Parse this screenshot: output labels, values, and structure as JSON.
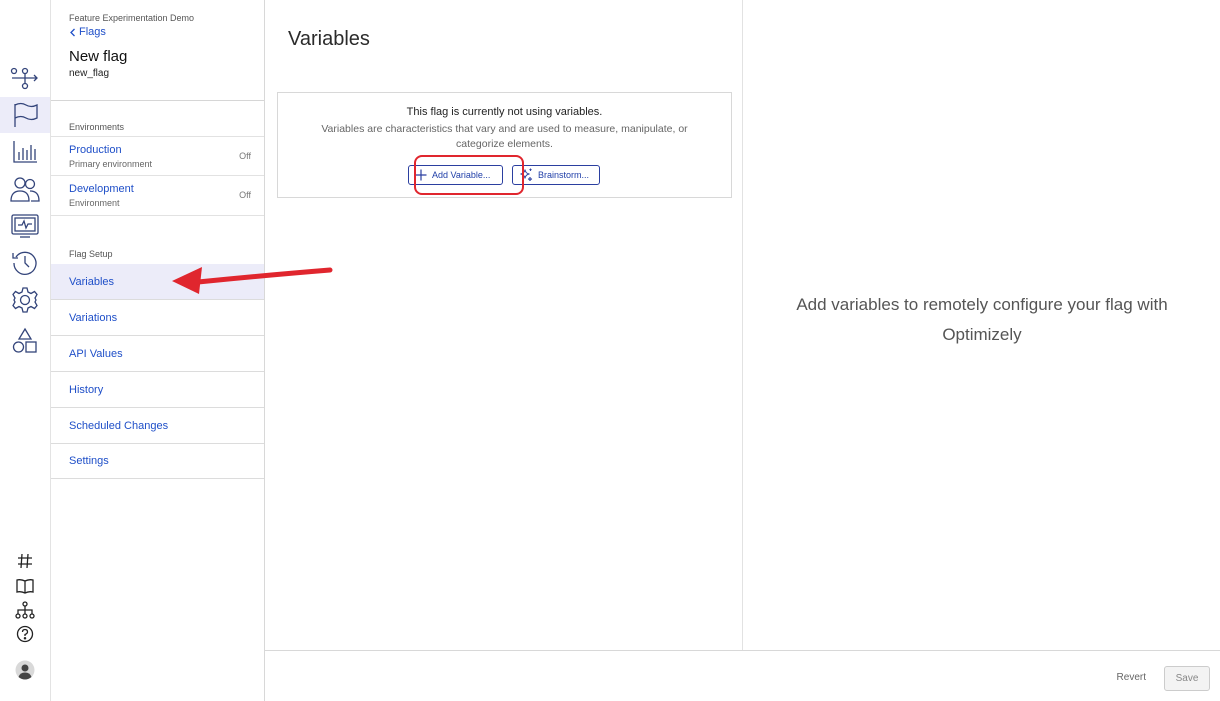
{
  "header": {
    "project": "Feature Experimentation Demo",
    "back_label": "Flags",
    "flag_name": "New flag",
    "flag_key": "new_flag"
  },
  "environments": {
    "label": "Environments",
    "items": [
      {
        "name": "Production",
        "subtitle": "Primary environment",
        "status": "Off"
      },
      {
        "name": "Development",
        "subtitle": "Environment",
        "status": "Off"
      }
    ]
  },
  "flag_setup": {
    "label": "Flag Setup",
    "items": [
      {
        "label": "Variables",
        "active": true
      },
      {
        "label": "Variations"
      },
      {
        "label": "API Values"
      },
      {
        "label": "History"
      },
      {
        "label": "Scheduled Changes"
      },
      {
        "label": "Settings"
      }
    ]
  },
  "main": {
    "title": "Variables",
    "empty_title": "This flag is currently not using variables.",
    "empty_desc": "Variables are characteristics that vary and are used to measure, manipulate, or categorize elements.",
    "add_variable_label": "Add Variable...",
    "brainstorm_label": "Brainstorm..."
  },
  "right_panel": {
    "message": "Add variables to remotely configure your flag with Optimizely"
  },
  "footer": {
    "revert_label": "Revert",
    "save_label": "Save"
  },
  "rail_icons": [
    "flows-icon",
    "flag-icon",
    "reports-icon",
    "audiences-icon",
    "monitor-icon",
    "history-icon",
    "settings-icon",
    "shapes-icon",
    "hash-icon",
    "book-icon",
    "hierarchy-icon",
    "help-icon",
    "user-avatar"
  ],
  "colors": {
    "link": "#1f4fc8",
    "active_bg": "#ececf9",
    "highlight": "#e0262e"
  }
}
